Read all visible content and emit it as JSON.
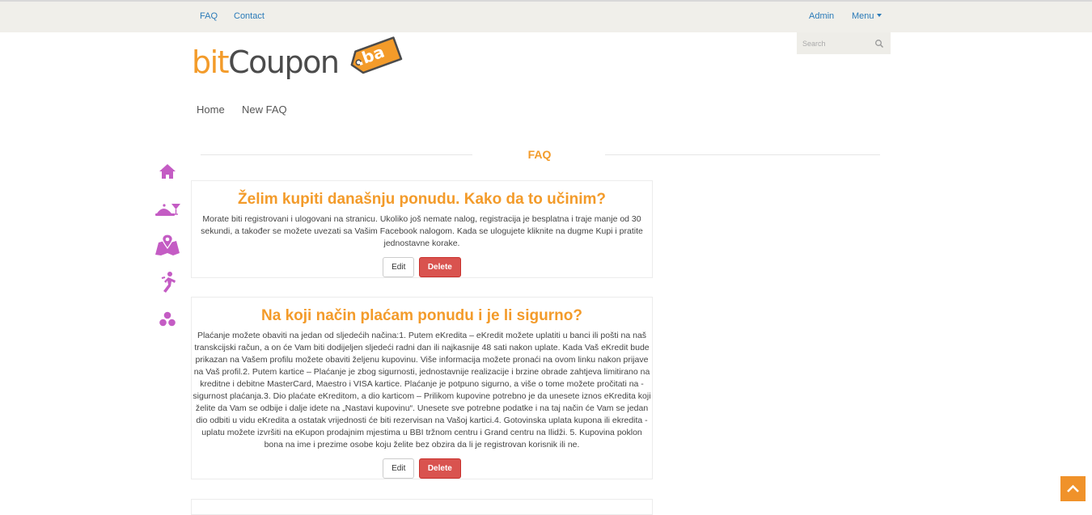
{
  "topbar": {
    "faq_label": "FAQ",
    "contact_label": "Contact",
    "admin_label": "Admin",
    "menu_label": "Menu"
  },
  "search": {
    "placeholder": "Search"
  },
  "logo": {
    "text_bit": "bit",
    "text_coupon": "Coupon",
    "tag_text": ".ba"
  },
  "subnav": {
    "home_label": "Home",
    "new_faq_label": "New FAQ"
  },
  "section_title": "FAQ",
  "sidebar_icons": [
    "home-icon",
    "food-tray-icon",
    "map-location-icon",
    "activity-person-icon",
    "more-dots-icon"
  ],
  "faqs": [
    {
      "question": "Želim kupiti današnju ponudu. Kako da to učinim?",
      "answer": "Morate biti registrovani i ulogovani na stranicu. Ukoliko još nemate nalog, registracija je besplatna i traje manje od 30 sekundi, a također se možete uvezati sa Vašim Facebook nalogom. Kada se ulogujete kliknite na dugme Kupi i pratite jednostavne korake.",
      "edit_label": "Edit",
      "delete_label": "Delete"
    },
    {
      "question": "Na koji način plaćam ponudu i je li sigurno?",
      "answer": "Plaćanje možete obaviti na jedan od sljedećih načina:1. Putem eKredita – eKredit možete uplatiti u banci ili pošti na naš transkcijski račun, a on će Vam biti dodijeljen sljedeći radni dan ili najkasnije 48 sati nakon uplate. Kada Vaš eKredit bude prikazan na Vašem profilu možete obaviti željenu kupovinu. Više informacija možete pronaći na ovom linku nakon prijave na Vaš profil.2. Putem kartice – Plaćanje je zbog sigurnosti, jednostavnije realizacije i brzine obrade zahtjeva limitirano na kreditne i debitne MasterCard, Maestro i VISA kartice. Plaćanje je potpuno sigurno, a više o tome možete pročitati na - sigurnost plaćanja.3. Dio plaćate eKreditom, a dio karticom – Prilikom kupovine potrebno je da unesete iznos eKredita koji želite da Vam se odbije i dalje idete na „Nastavi kupovinu“. Unesete sve potrebne podatke i na taj način će Vam se jedan dio odbiti u vidu eKredita a ostatak vrijednosti će biti rezervisan na Vašoj kartici.4. Gotovinska uplata kupona ili ekredita - uplatu možete izvršiti na eKupon prodajnim mjestima u BBI tržnom centru i Grand centru na Ilidži. 5. Kupovina poklon bona na ime i prezime osobe koju želite bez obzira da li je registrovan korisnik ili ne.",
      "edit_label": "Edit",
      "delete_label": "Delete"
    }
  ],
  "colors": {
    "accent": "#f39b2a",
    "link": "#2a7ab8",
    "danger": "#d9534f",
    "sidebar_icon": "#c45cc4",
    "topbar_bg": "#f0efea"
  }
}
